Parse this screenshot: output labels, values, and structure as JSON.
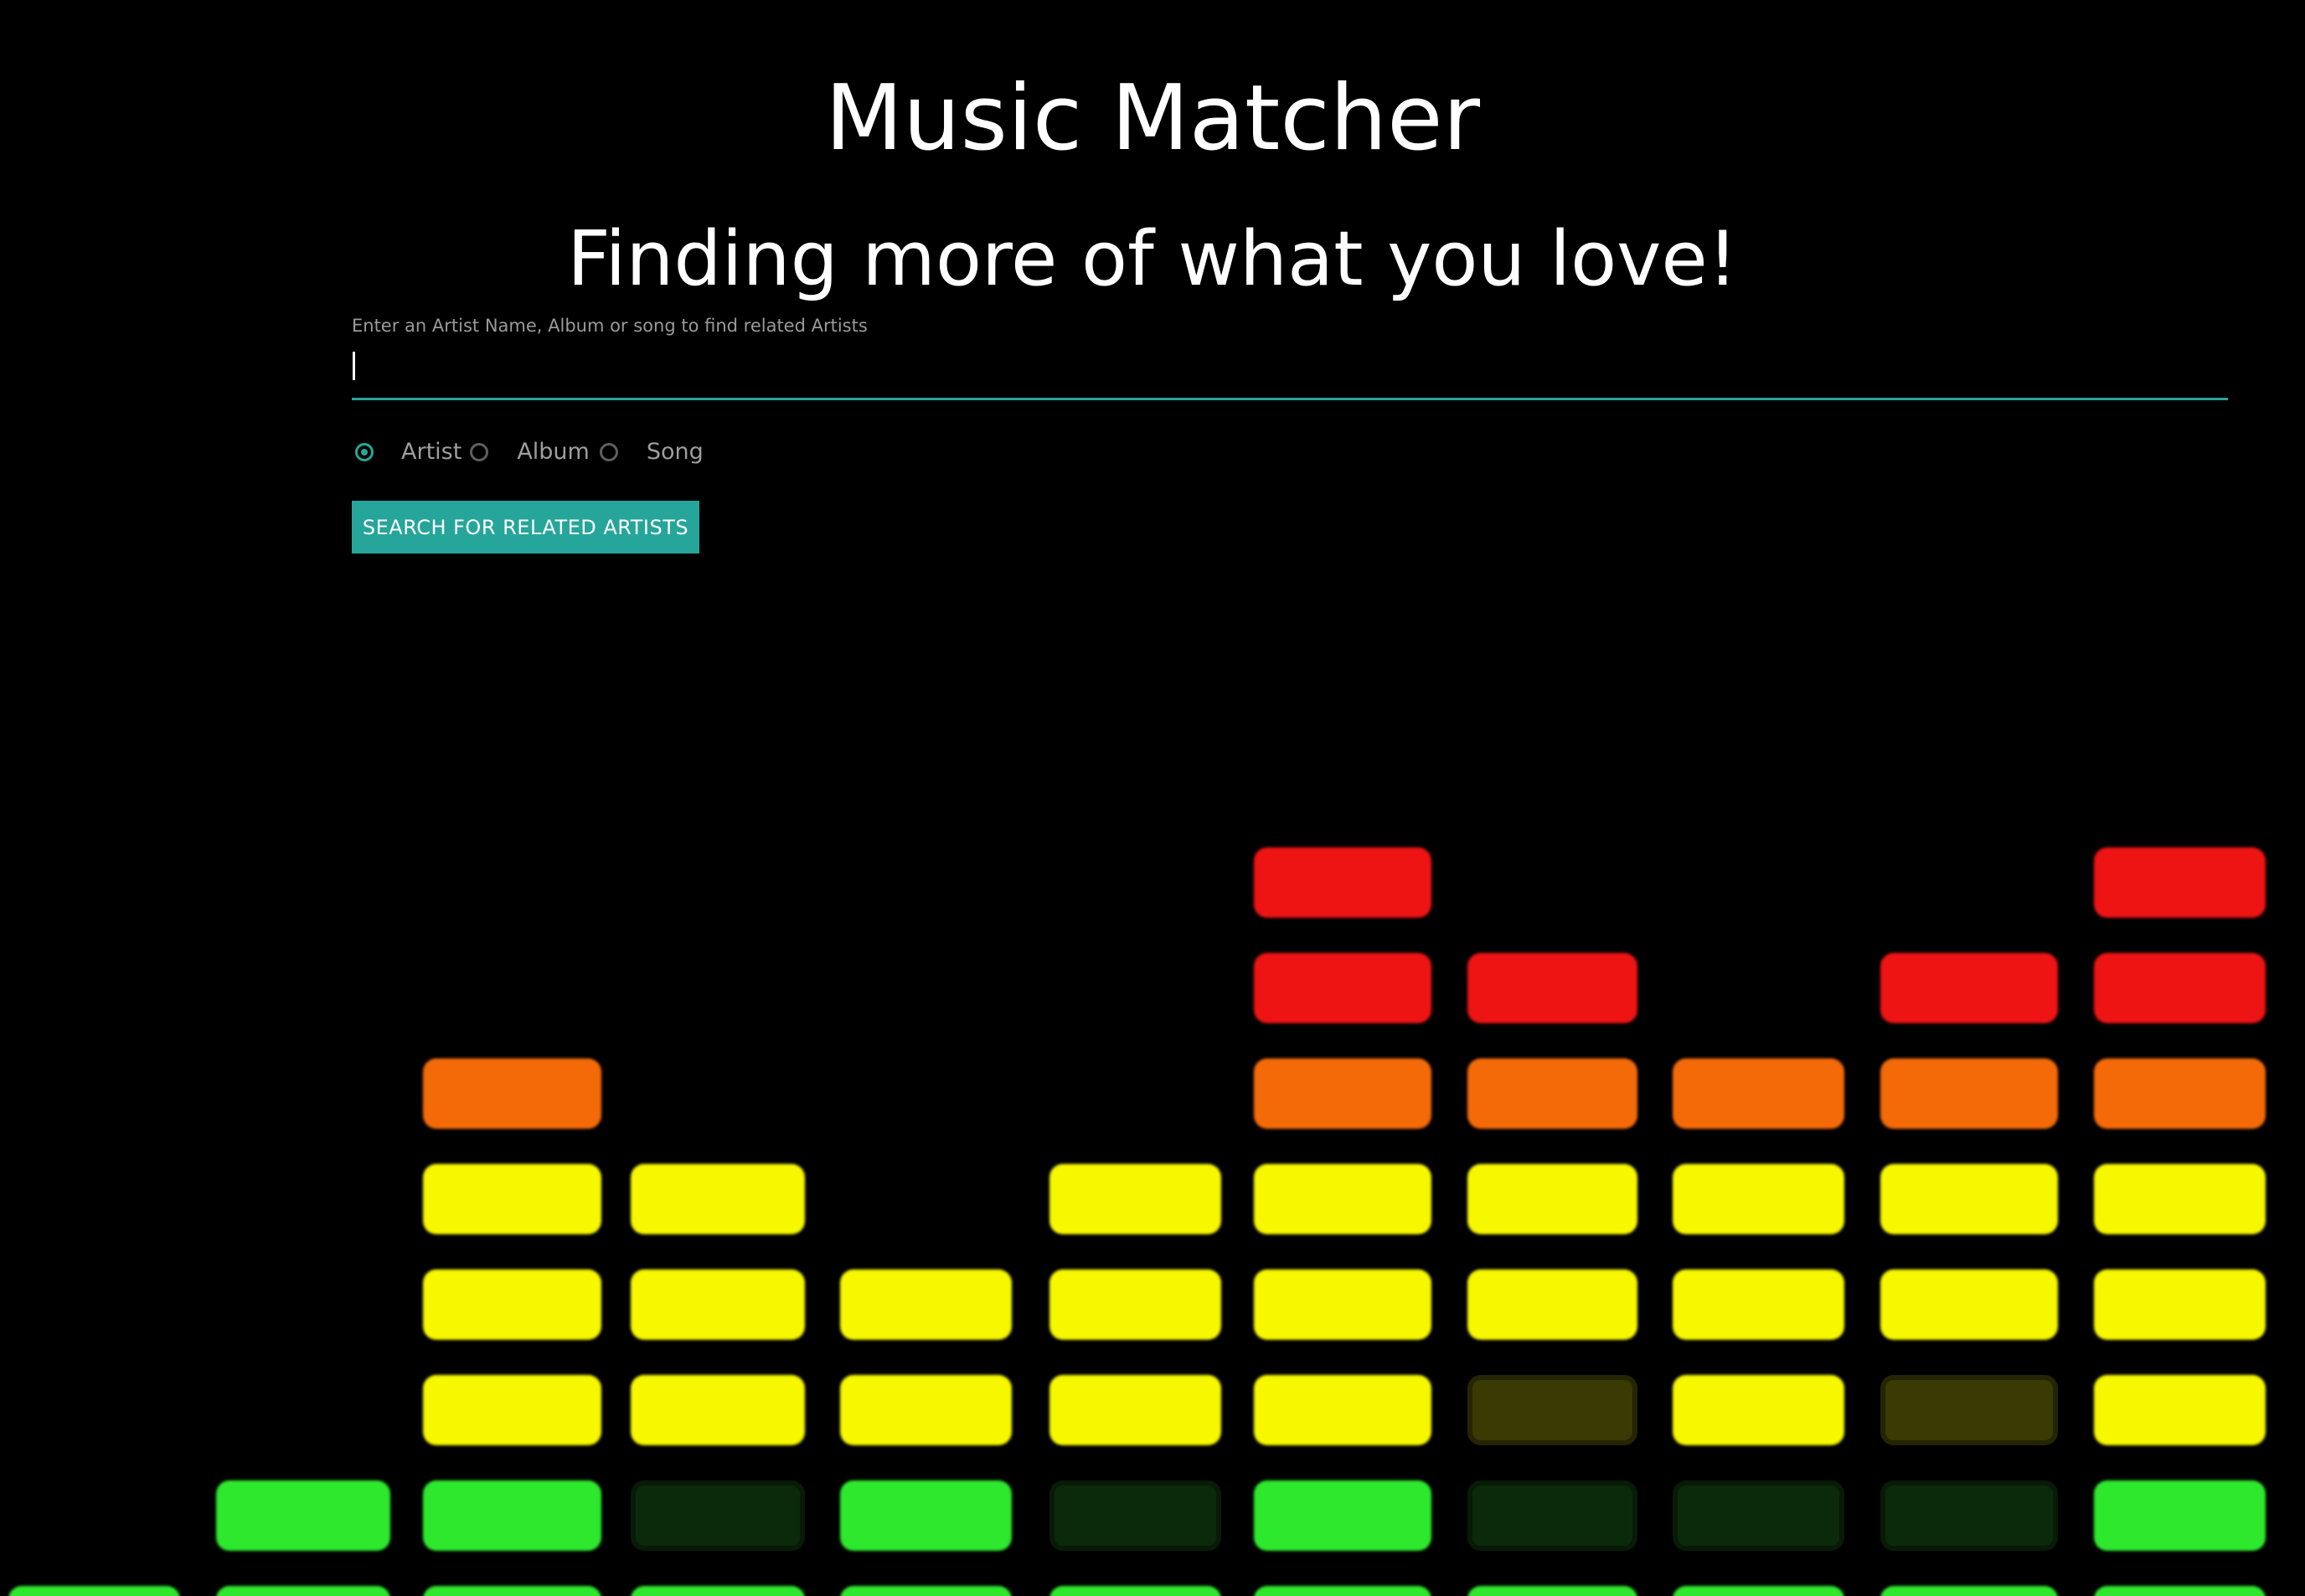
{
  "header": {
    "title": "Music Matcher",
    "subtitle": "Finding more of what you love!"
  },
  "search": {
    "label": "Enter an Artist Name, Album or song to find related Artists",
    "value": "",
    "placeholder": ""
  },
  "search_type": {
    "selected": "Artist",
    "options": [
      {
        "label": "Artist",
        "checked": true
      },
      {
        "label": "Album",
        "checked": false
      },
      {
        "label": "Song",
        "checked": false
      }
    ]
  },
  "actions": {
    "search_button_label": "SEARCH FOR RELATED ARTISTS"
  },
  "colors": {
    "accent": "#26a69a",
    "background": "#000000",
    "eq_red": "#ee1414",
    "eq_orange": "#f56a08",
    "eq_yellow": "#f7f700",
    "eq_green": "#2ee82e",
    "eq_dim_yellow": "#3a3a05",
    "eq_dim_green": "#0b2a0b"
  },
  "background_image": {
    "description_icon": "equalizer-icon",
    "columns": [
      {
        "levels": [
          "green"
        ]
      },
      {
        "levels": [
          "green",
          "green"
        ]
      },
      {
        "levels": [
          "green",
          "green",
          "yellow",
          "yellow",
          "yellow",
          "orange"
        ]
      },
      {
        "levels": [
          "green",
          "dim-green",
          "yellow",
          "yellow",
          "yellow"
        ]
      },
      {
        "levels": [
          "green",
          "green",
          "yellow",
          "yellow"
        ]
      },
      {
        "levels": [
          "green",
          "dim-green",
          "yellow",
          "yellow",
          "yellow"
        ]
      },
      {
        "levels": [
          "green",
          "green",
          "yellow",
          "yellow",
          "yellow",
          "orange",
          "red",
          "red"
        ]
      },
      {
        "levels": [
          "green",
          "dim-green",
          "dim-yellow",
          "yellow",
          "yellow",
          "orange",
          "red"
        ]
      },
      {
        "levels": [
          "green",
          "dim-green",
          "yellow",
          "yellow",
          "yellow",
          "orange"
        ]
      },
      {
        "levels": [
          "green",
          "dim-green",
          "dim-yellow",
          "yellow",
          "yellow",
          "orange",
          "red"
        ]
      },
      {
        "levels": [
          "green",
          "green",
          "yellow",
          "yellow",
          "yellow",
          "orange",
          "red",
          "red"
        ]
      }
    ]
  }
}
